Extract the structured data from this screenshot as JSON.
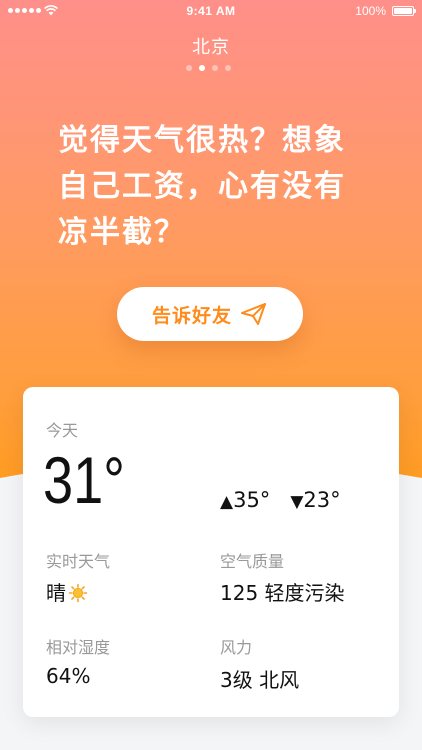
{
  "status_bar": {
    "time": "9:41 AM",
    "battery": "100%"
  },
  "city": {
    "name": "北京",
    "page_count": 4,
    "active_page": 2
  },
  "headline": {
    "lines": [
      "觉得天气很热？想象",
      "自己工资，心有没有",
      "凉半截？"
    ]
  },
  "share_button": {
    "label": "告诉好友",
    "icon": "send-icon"
  },
  "today": {
    "label": "今天",
    "temperature": "31°",
    "high": "35°",
    "low": "23°"
  },
  "details": {
    "realtime": {
      "label": "实时天气",
      "value": "晴",
      "icon": "sun-icon"
    },
    "air_quality": {
      "label": "空气质量",
      "value": "125 轻度污染"
    },
    "humidity": {
      "label": "相对湿度",
      "value": "64%"
    },
    "wind": {
      "label": "风力",
      "value": "3级 北风"
    }
  },
  "colors": {
    "gradient_top": "#ff8f8a",
    "gradient_bottom": "#ff9b17",
    "accent": "#ff8c1a",
    "text_primary": "#111111",
    "text_secondary": "#999999"
  }
}
